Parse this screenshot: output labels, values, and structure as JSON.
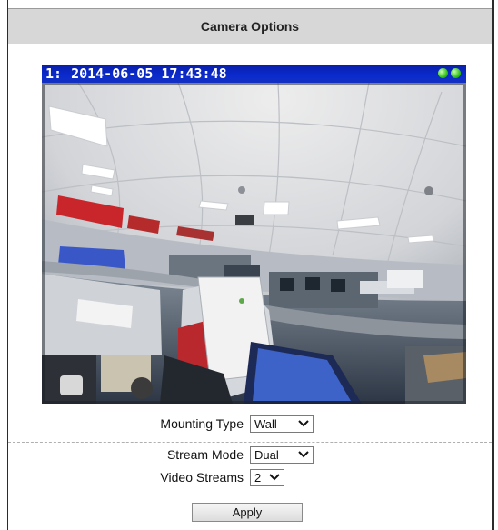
{
  "header": {
    "title": "Camera Options"
  },
  "video": {
    "channel": "1:",
    "timestamp": "2014-06-05 17:43:48",
    "status_icons": [
      "green-status-icon",
      "green-status-icon"
    ]
  },
  "form": {
    "mounting_type": {
      "label": "Mounting Type",
      "value": "Wall"
    },
    "stream_mode": {
      "label": "Stream Mode",
      "value": "Dual"
    },
    "video_streams": {
      "label": "Video Streams",
      "value": "2"
    },
    "apply_label": "Apply"
  },
  "colors": {
    "header_bg": "#d7d7d7",
    "osd_bg": "#0a2ad0",
    "status_green": "#33c21a"
  }
}
